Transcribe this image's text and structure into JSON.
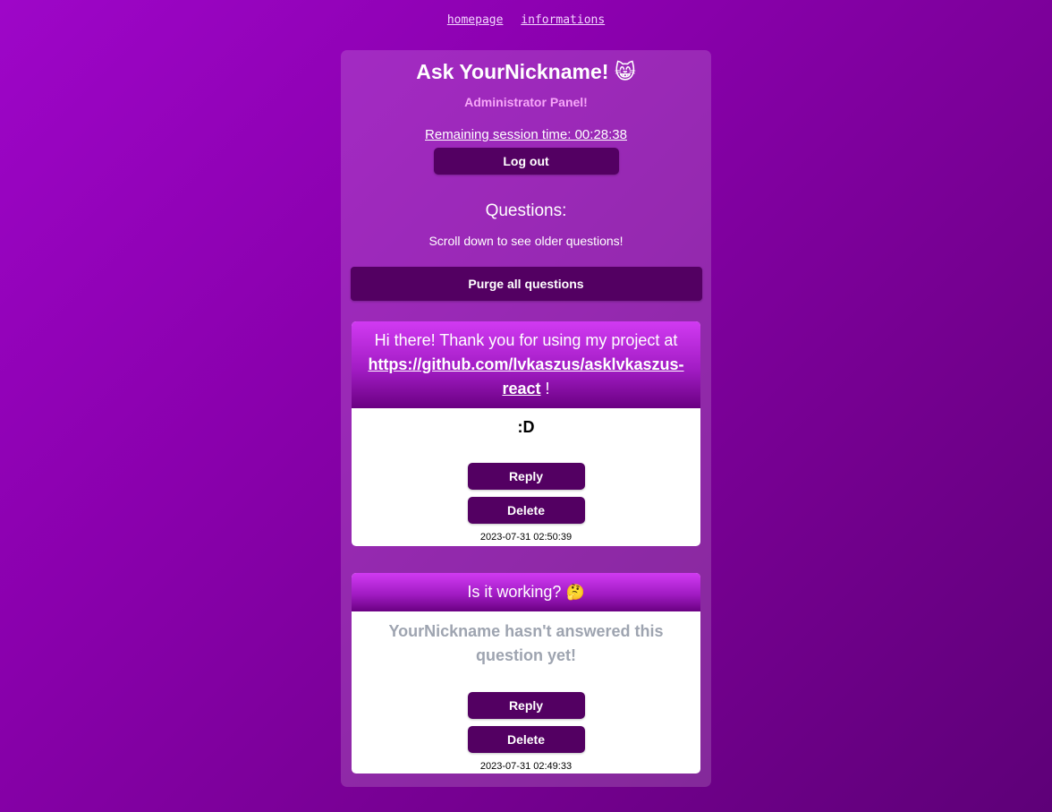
{
  "nav": {
    "homepage": "homepage",
    "informations": "informations"
  },
  "panel": {
    "title": "Ask YourNickname!",
    "title_emoji": "😸",
    "subtitle": "Administrator Panel!",
    "session_label": "Remaining session time: 00:28:38",
    "logout_label": "Log out",
    "questions_heading": "Questions:",
    "questions_hint": "Scroll down to see older questions!",
    "purge_label": "Purge all questions"
  },
  "questions": [
    {
      "text_before": "Hi there! Thank you for using my project at ",
      "link": "https://github.com/lvkaszus/asklvkaszus-react",
      "text_after": " !",
      "answer": ":D",
      "reply_label": "Reply",
      "delete_label": "Delete",
      "timestamp": "2023-07-31 02:50:39"
    },
    {
      "text": "Is it working?",
      "emoji": "🤔",
      "answer": "YourNickname hasn't answered this question yet!",
      "reply_label": "Reply",
      "delete_label": "Delete",
      "timestamp": "2023-07-31 02:49:33"
    }
  ],
  "colors": {
    "background_start": "#9e06c8",
    "background_end": "#5e0078",
    "button": "#530062",
    "subtitle": "#f7a7f9",
    "unanswered_text": "#9ea4b0"
  }
}
